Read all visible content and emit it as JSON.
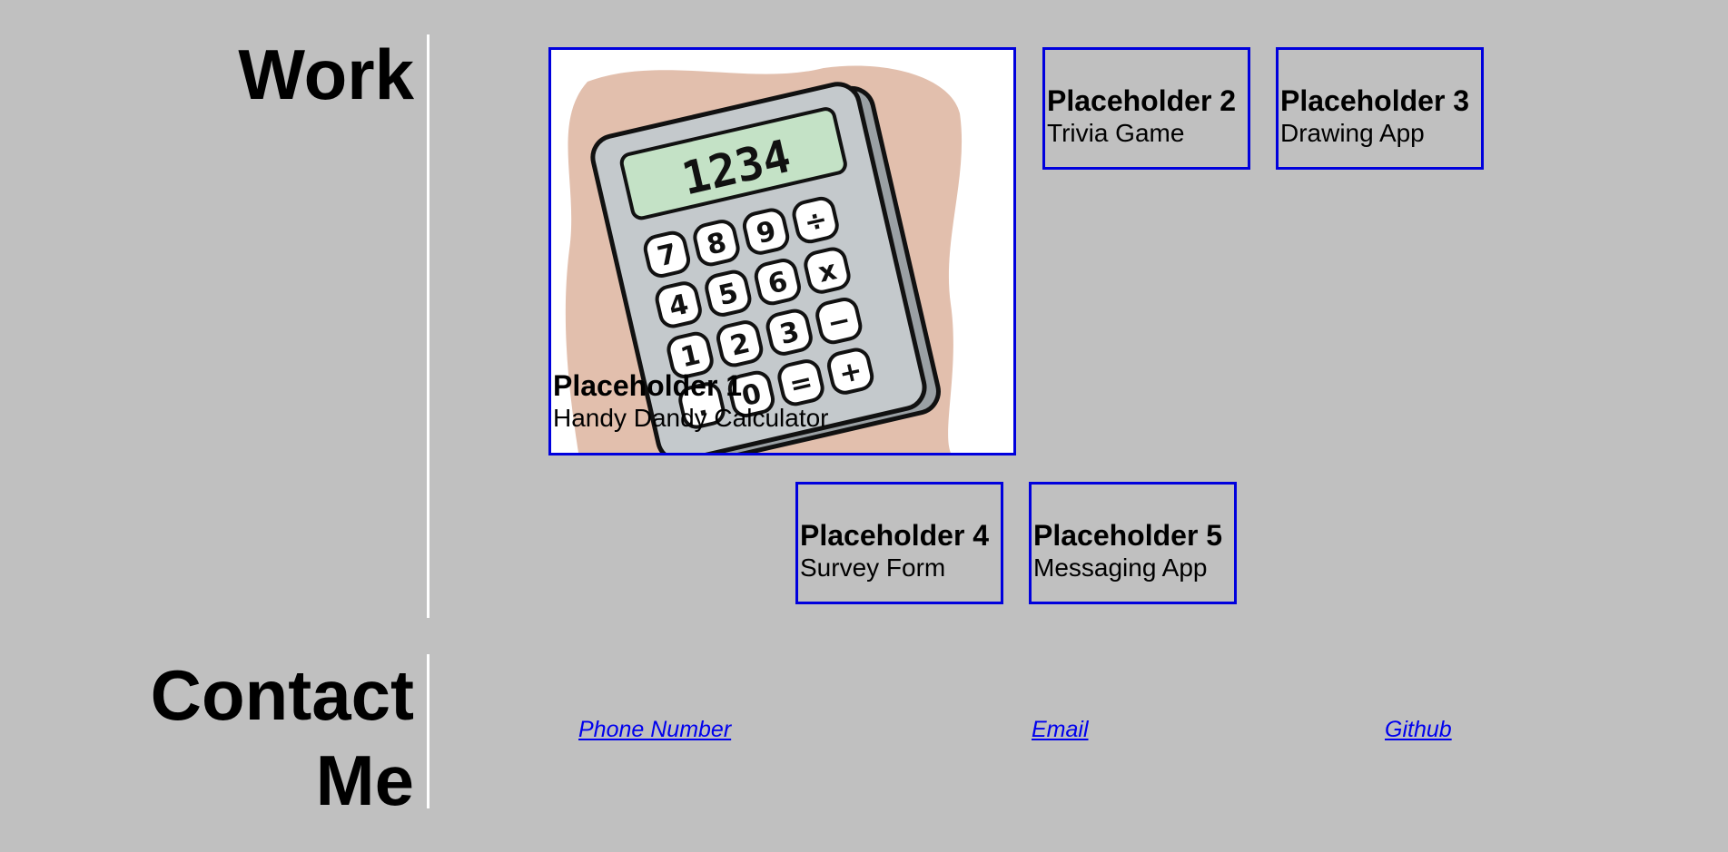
{
  "work": {
    "title": "Work",
    "projects": [
      {
        "name": "Placeholder 1",
        "description": "Handy Dandy Calculator",
        "image": "calculator-illustration",
        "display": "1234"
      },
      {
        "name": "Placeholder 2",
        "description": "Trivia Game"
      },
      {
        "name": "Placeholder 3",
        "description": "Drawing App"
      },
      {
        "name": "Placeholder 4",
        "description": "Survey Form"
      },
      {
        "name": "Placeholder 5",
        "description": "Messaging App"
      }
    ]
  },
  "contact": {
    "title": "Contact Me",
    "links": [
      {
        "label": "Phone Number"
      },
      {
        "label": "Email"
      },
      {
        "label": "Github"
      }
    ]
  },
  "colors": {
    "background": "#c0c0c0",
    "card_border": "#0000dd",
    "link": "#0000ee",
    "divider": "#ffffff"
  }
}
